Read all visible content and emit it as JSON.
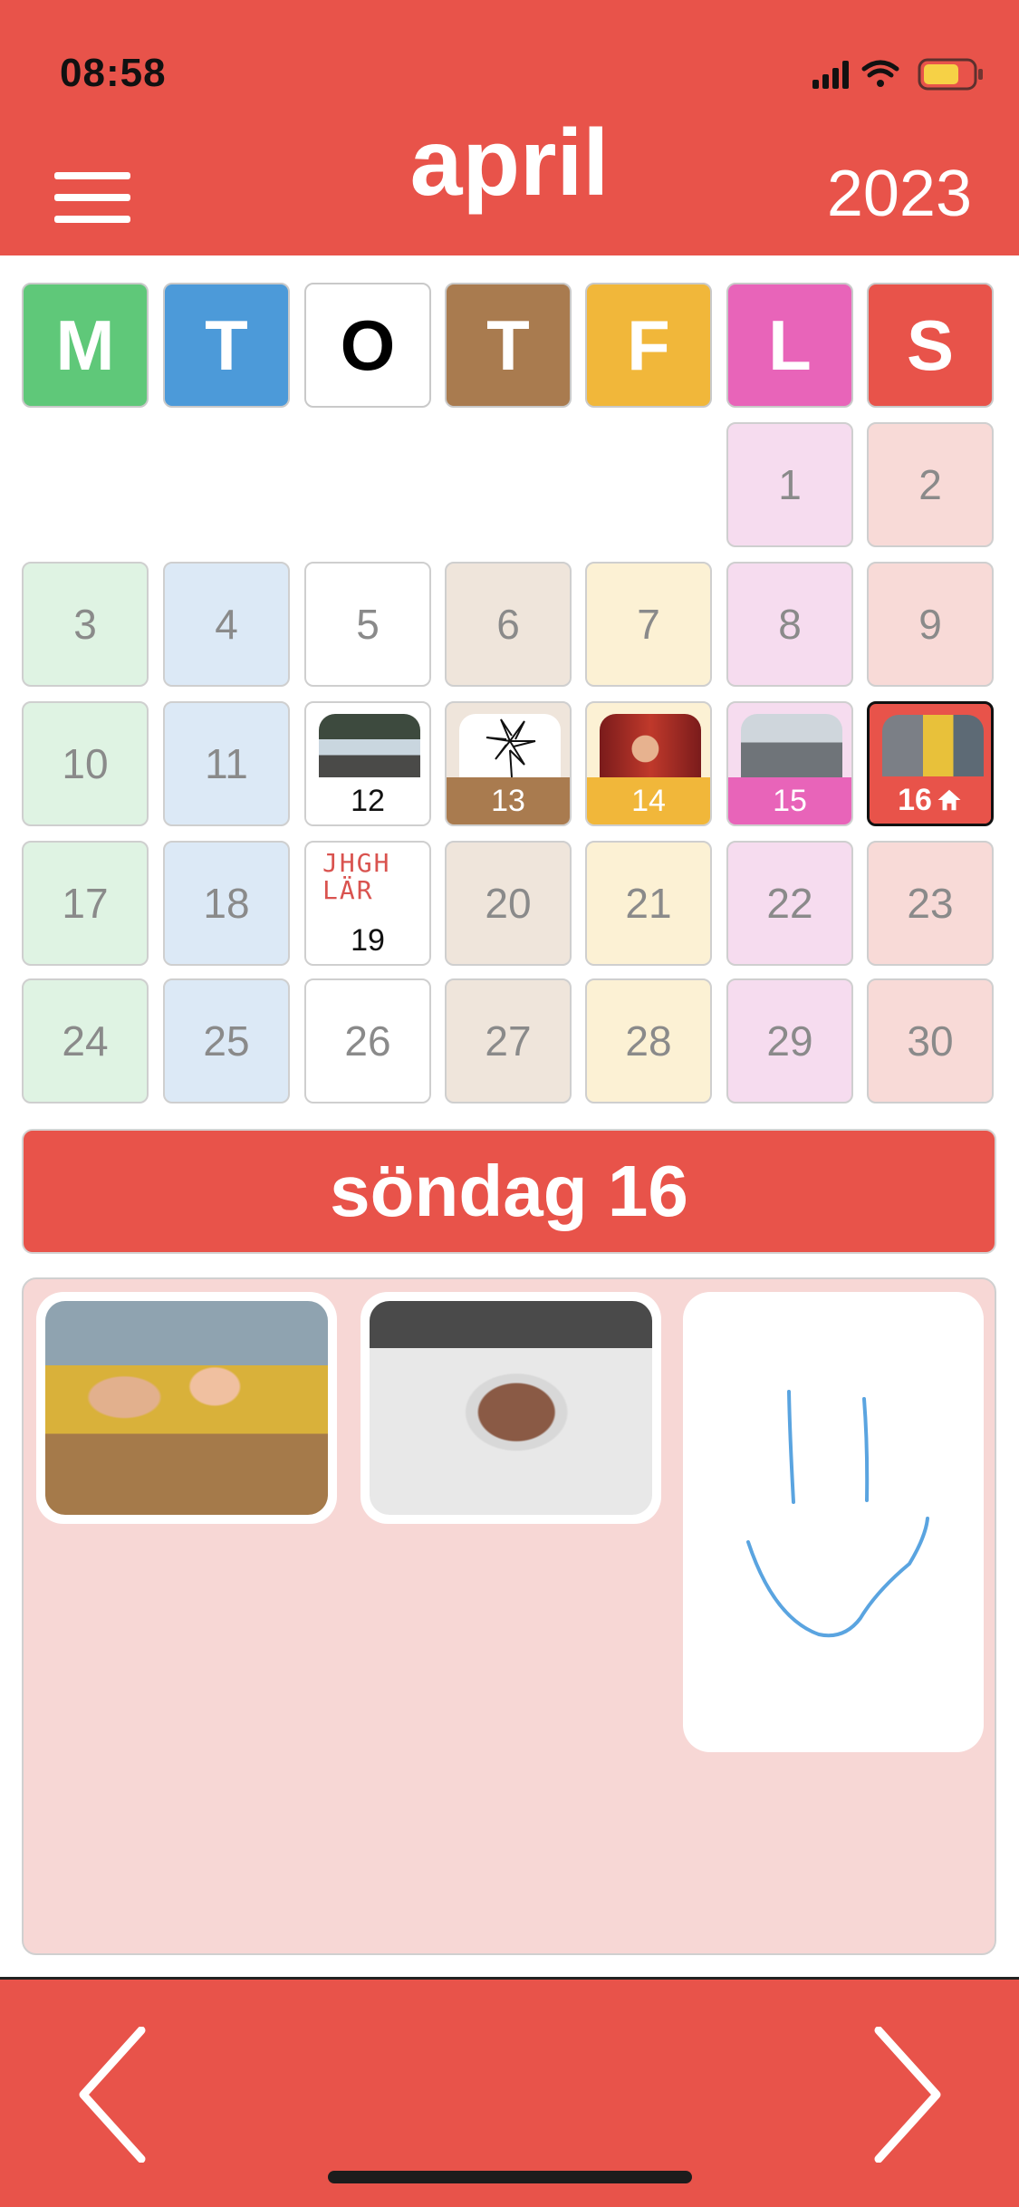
{
  "status_bar": {
    "time": "08:58"
  },
  "header": {
    "month": "april",
    "year": "2023"
  },
  "weekdays": [
    {
      "label": "M",
      "color": "#5fc879",
      "text_color": "#ffffff"
    },
    {
      "label": "T",
      "color": "#4c9ad9",
      "text_color": "#ffffff"
    },
    {
      "label": "O",
      "color": "#ffffff",
      "text_color": "#000000"
    },
    {
      "label": "T",
      "color": "#a97b4f",
      "text_color": "#ffffff"
    },
    {
      "label": "F",
      "color": "#f1b73a",
      "text_color": "#ffffff"
    },
    {
      "label": "L",
      "color": "#e864b9",
      "text_color": "#ffffff"
    },
    {
      "label": "S",
      "color": "#e8534a",
      "text_color": "#ffffff"
    }
  ],
  "days": {
    "d1": "1",
    "d2": "2",
    "d3": "3",
    "d4": "4",
    "d5": "5",
    "d6": "6",
    "d7": "7",
    "d8": "8",
    "d9": "9",
    "d10": "10",
    "d11": "11",
    "d12": "12",
    "d13": "13",
    "d14": "14",
    "d15": "15",
    "d16": "16",
    "d17": "17",
    "d18": "18",
    "d19": "19",
    "d20": "20",
    "d21": "21",
    "d22": "22",
    "d23": "23",
    "d24": "24",
    "d25": "25",
    "d26": "26",
    "d27": "27",
    "d28": "28",
    "d29": "29",
    "d30": "30"
  },
  "cell_colors": {
    "mon": "#dff3e3",
    "tue": "#dce9f6",
    "wed": "#ffffff",
    "thu": "#efe5db",
    "fri": "#fcf1d4",
    "sat": "#f6dcef",
    "sun": "#f8dad7"
  },
  "doodle_text_19": [
    "JHGH",
    "LÄR"
  ],
  "selected": {
    "title": "söndag 16"
  },
  "icons": {
    "menu": "hamburger-menu-icon",
    "home": "home-icon",
    "prev": "chevron-left-icon",
    "next": "chevron-right-icon"
  }
}
